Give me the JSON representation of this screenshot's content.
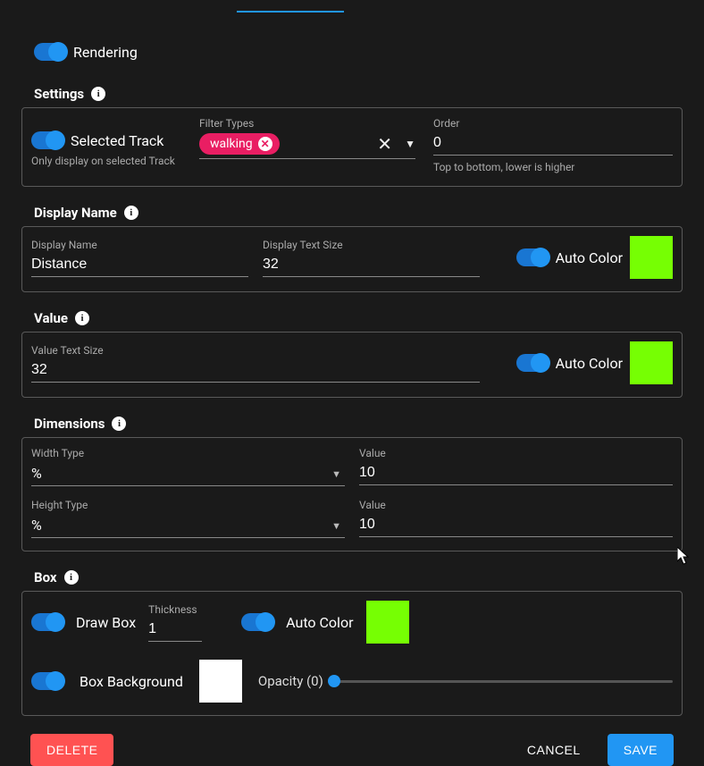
{
  "toggles": {
    "rendering": "Rendering"
  },
  "sections": {
    "settings": "Settings",
    "display_name": "Display Name",
    "value": "Value",
    "dimensions": "Dimensions",
    "box": "Box"
  },
  "settings": {
    "selected_track_label": "Selected Track",
    "selected_hint": "Only display on selected Track",
    "filter_types_label": "Filter Types",
    "filter_chip": "walking",
    "order_label": "Order",
    "order_value": "0",
    "order_hint": "Top to bottom, lower is higher"
  },
  "display_name": {
    "name_label": "Display Name",
    "name_value": "Distance",
    "size_label": "Display Text Size",
    "size_value": "32",
    "auto_color": "Auto Color",
    "color": "#76ff03"
  },
  "value": {
    "size_label": "Value Text Size",
    "size_value": "32",
    "auto_color": "Auto Color",
    "color": "#76ff03"
  },
  "dimensions": {
    "width_type_label": "Width Type",
    "width_type": "%",
    "width_value_label": "Value",
    "width_value": "10",
    "height_type_label": "Height Type",
    "height_type": "%",
    "height_value_label": "Value",
    "height_value": "10"
  },
  "box": {
    "draw_label": "Draw Box",
    "thickness_label": "Thickness",
    "thickness_value": "1",
    "auto_color": "Auto Color",
    "color": "#76ff03",
    "bg_label": "Box Background",
    "bg_color": "#ffffff",
    "opacity_label": "Opacity (0)"
  },
  "footer": {
    "delete": "DELETE",
    "cancel": "CANCEL",
    "save": "SAVE"
  }
}
